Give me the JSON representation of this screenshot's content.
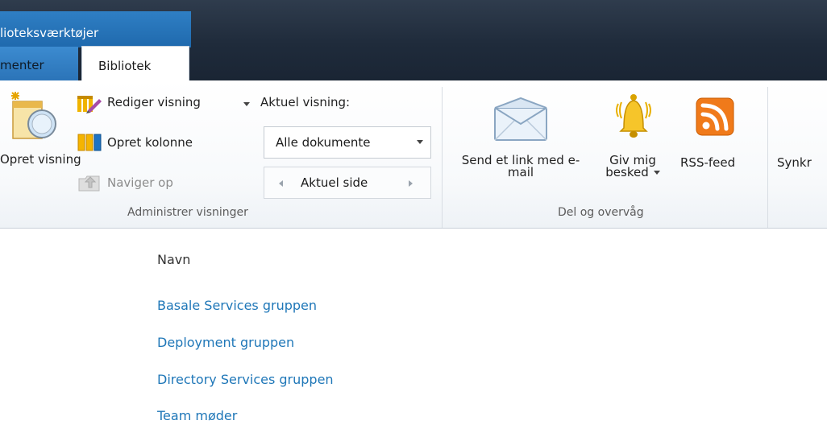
{
  "header": {
    "tool_group_label": "lioteksværktøjer",
    "tabs": [
      {
        "label": "menter",
        "active": false
      },
      {
        "label": "Bibliotek",
        "active": true
      }
    ]
  },
  "ribbon": {
    "manage_views": {
      "create_view_label": "Opret visning",
      "edit_view_label": "Rediger visning",
      "current_view_label": "Aktuel visning:",
      "create_column_label": "Opret kolonne",
      "navigate_up_label": "Naviger op",
      "current_view_value": "Alle dokumente",
      "current_page_label": "Aktuel side",
      "group_label": "Administrer visninger"
    },
    "share_track": {
      "email_link_label": "Send et link med e-mail",
      "alert_me_label": "Giv mig besked",
      "rss_label": "RSS-feed",
      "group_label": "Del og overvåg"
    },
    "sync_label_partial": "Synkr"
  },
  "list": {
    "column_header": "Navn",
    "items": [
      "Basale Services gruppen",
      "Deployment gruppen",
      "Directory Services gruppen",
      "Team møder"
    ]
  },
  "colors": {
    "tool_group_bg": "#2a78bd",
    "title_bar_bg": "#1f2b3b",
    "link": "#1f77b8"
  }
}
